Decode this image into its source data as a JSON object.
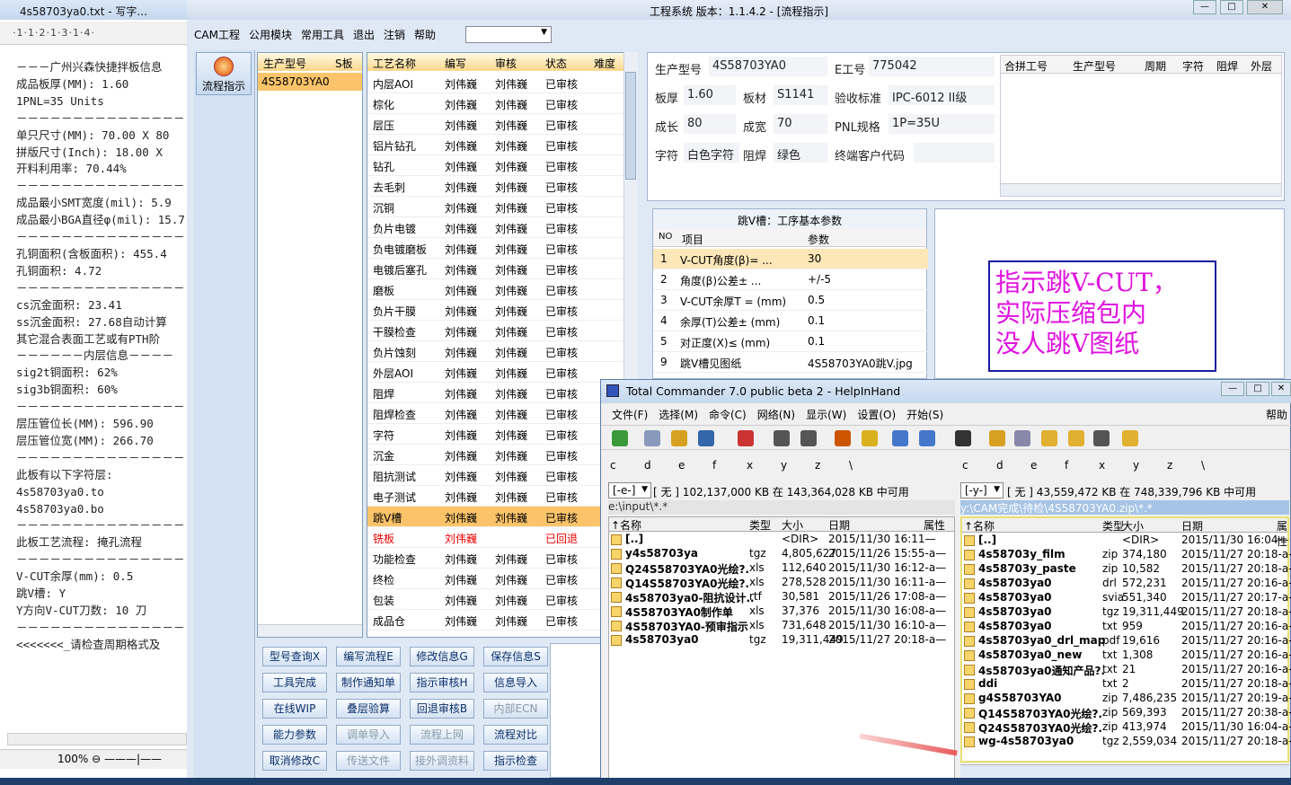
{
  "notepad": {
    "title": "4s58703ya0.txt - 写字...",
    "ruler": "·1·1·2·1·3·1·4·",
    "lines": [
      "－－－广州兴森快捷拌板信息",
      "成品板厚(MM): 1.60",
      "1PNL=35 Units",
      "－－－－－－－－－－－－－－－",
      "单只尺寸(MM): 70.00 X 80",
      "拼版尺寸(Inch): 18.00 X",
      "开料利用率: 70.44%",
      "－－－－－－－－－－－－－－－",
      "成品最小SMT宽度(mil): 5.9",
      "成品最小BGA直径φ(mil): 15.7",
      "－－－－－－－－－－－－－－－",
      "孔铜面积(含板面积): 455.4",
      "孔铜面积: 4.72",
      "－－－－－－－－－－－－－－－",
      "cs沉金面积: 23.41",
      "ss沉金面积: 27.68自动计算",
      "其它混合表面工艺或有PTH阶",
      "－－－－－－内层信息－－－－",
      "sig2t铜面积: 62%",
      "sig3b铜面积: 60%",
      "－－－－－－－－－－－－－－－",
      "层压管位长(MM): 596.90",
      "层压管位宽(MM): 266.70",
      "－－－－－－－－－－－－－－－",
      "此板有以下字符层:",
      "4s58703ya0.to",
      "4s58703ya0.bo",
      "－－－－－－－－－－－－－－－",
      "此板工艺流程: 掩孔流程",
      "－－－－－－－－－－－－－－－",
      "V-CUT余厚(mm): 0.5",
      "跳V槽: Y",
      "Y方向V-CUT刀数: 10 刀",
      "－－－－－－－－－－－－－－－",
      "<<<<<<<_请检查周期格式及"
    ],
    "zoom": "100%"
  },
  "app": {
    "title": "工程系统   版本：1.1.4.2 - [流程指示]",
    "menu": [
      "CAM工程",
      "公用模块",
      "常用工具",
      "退出",
      "注销",
      "帮助"
    ],
    "left_button": "流程指示",
    "prod_list": {
      "headers": [
        "生产型号",
        "S板"
      ],
      "rows": [
        "4S58703YA0"
      ]
    },
    "proc_list": {
      "headers": [
        "工艺名称",
        "编写",
        "审核",
        "状态",
        "难度"
      ],
      "rows": [
        [
          "内层AOI",
          "刘伟巍",
          "刘伟巍",
          "已审核"
        ],
        [
          "棕化",
          "刘伟巍",
          "刘伟巍",
          "已审核"
        ],
        [
          "层压",
          "刘伟巍",
          "刘伟巍",
          "已审核"
        ],
        [
          "铝片钻孔",
          "刘伟巍",
          "刘伟巍",
          "已审核"
        ],
        [
          "钻孔",
          "刘伟巍",
          "刘伟巍",
          "已审核"
        ],
        [
          "去毛刺",
          "刘伟巍",
          "刘伟巍",
          "已审核"
        ],
        [
          "沉铜",
          "刘伟巍",
          "刘伟巍",
          "已审核"
        ],
        [
          "负片电镀",
          "刘伟巍",
          "刘伟巍",
          "已审核"
        ],
        [
          "负电镀磨板",
          "刘伟巍",
          "刘伟巍",
          "已审核"
        ],
        [
          "电镀后塞孔",
          "刘伟巍",
          "刘伟巍",
          "已审核"
        ],
        [
          "磨板",
          "刘伟巍",
          "刘伟巍",
          "已审核"
        ],
        [
          "负片干膜",
          "刘伟巍",
          "刘伟巍",
          "已审核"
        ],
        [
          "干膜检查",
          "刘伟巍",
          "刘伟巍",
          "已审核"
        ],
        [
          "负片蚀刻",
          "刘伟巍",
          "刘伟巍",
          "已审核"
        ],
        [
          "外层AOI",
          "刘伟巍",
          "刘伟巍",
          "已审核"
        ],
        [
          "阻焊",
          "刘伟巍",
          "刘伟巍",
          "已审核"
        ],
        [
          "阻焊检查",
          "刘伟巍",
          "刘伟巍",
          "已审核"
        ],
        [
          "字符",
          "刘伟巍",
          "刘伟巍",
          "已审核"
        ],
        [
          "沉金",
          "刘伟巍",
          "刘伟巍",
          "已审核"
        ],
        [
          "阻抗测试",
          "刘伟巍",
          "刘伟巍",
          "已审核"
        ],
        [
          "电子测试",
          "刘伟巍",
          "刘伟巍",
          "已审核"
        ],
        [
          "跳V槽",
          "刘伟巍",
          "刘伟巍",
          "已审核"
        ],
        [
          "铣板",
          "刘伟巍",
          "",
          "已回退"
        ],
        [
          "功能检查",
          "刘伟巍",
          "刘伟巍",
          "已审核"
        ],
        [
          "终检",
          "刘伟巍",
          "刘伟巍",
          "已审核"
        ],
        [
          "包装",
          "刘伟巍",
          "刘伟巍",
          "已审核"
        ],
        [
          "成品仓",
          "刘伟巍",
          "刘伟巍",
          "已审核"
        ]
      ]
    },
    "buttons": [
      [
        "型号查询X",
        "编写流程E",
        "修改信息G",
        "保存信息S"
      ],
      [
        "工具完成",
        "制作通知单",
        "指示审核H",
        "信息导入"
      ],
      [
        "在线WIP",
        "叠层验算",
        "回退审核B",
        "内部ECN"
      ],
      [
        "能力参数",
        "调单导入",
        "流程上网",
        "流程对比"
      ],
      [
        "取消修改C",
        "传送文件",
        "接外调资料",
        "指示检查"
      ]
    ],
    "info": {
      "prod_label": "生产型号",
      "prod": "4S58703YA0",
      "e_label": "E工号",
      "e": "775042",
      "thick_label": "板厚",
      "thick": "1.60",
      "mat_label": "板材",
      "mat": "S1141",
      "std_label": "验收标准",
      "std": "IPC-6012 II级",
      "len_label": "成长",
      "len": "80",
      "wid_label": "成宽",
      "wid": "70",
      "pnl_label": "PNL规格",
      "pnl": "1P=35U",
      "char_label": "字符",
      "char": "白色字符",
      "mask_label": "阻焊",
      "mask": "绿色",
      "cust_label": "终端客户代码",
      "right_headers": [
        "合拼工号",
        "生产型号",
        "周期",
        "字符",
        "阻焊",
        "外层"
      ]
    },
    "param_table": {
      "title": "跳V槽：工序基本参数",
      "headers": [
        "NO",
        "项目",
        "参数"
      ],
      "rows": [
        [
          "1",
          "V-CUT角度(β)=   ...",
          "30"
        ],
        [
          "2",
          "角度(β)公差±   ...",
          "+/-5"
        ],
        [
          "3",
          "V-CUT余厚T =  (mm)",
          "0.5"
        ],
        [
          "4",
          "余厚(T)公差±  (mm)",
          "0.1"
        ],
        [
          "5",
          "对正度(X)≤ (mm)",
          "0.1"
        ],
        [
          "9",
          "跳V槽见图纸",
          "4S58703YA0跳V.jpg"
        ]
      ]
    },
    "note": [
      "指示跳V-CUT，",
      "实际压缩包内",
      "没人跳V图纸"
    ]
  },
  "tc": {
    "title": "Total Commander 7.0 public beta 2 - HelpInHand",
    "menu": [
      "文件(F)",
      "选择(M)",
      "命令(C)",
      "网络(N)",
      "显示(W)",
      "设置(O)",
      "开始(S)"
    ],
    "help": "帮助",
    "drives_left": [
      "c",
      "d",
      "e",
      "f",
      "x",
      "y",
      "z",
      "\\"
    ],
    "drives_right": [
      "c",
      "d",
      "e",
      "f",
      "x",
      "y",
      "z",
      "\\"
    ],
    "left": {
      "drive": "[-e-]",
      "info": "[ 无 ]  102,137,000 KB 在 143,364,028 KB 中可用",
      "path": "e:\\input\\*.*",
      "headers": [
        "↑名称",
        "类型",
        "大小",
        "日期",
        "属性"
      ],
      "files": [
        [
          "[..]",
          "",
          "<DIR>",
          "2015/11/30 16:11—"
        ],
        [
          "y4s58703ya",
          "tgz",
          "4,805,627",
          "2015/11/26 15:55-a—"
        ],
        [
          "Q24S58703YA0光绘?.",
          "xls",
          "112,640",
          "2015/11/30 16:12-a—"
        ],
        [
          "Q14S58703YA0光绘?.",
          "xls",
          "278,528",
          "2015/11/30 16:11-a—"
        ],
        [
          "4s58703ya0-阻抗设计..",
          "rtf",
          "30,581",
          "2015/11/26 17:08-a—"
        ],
        [
          "4S58703YA0制作单",
          "xls",
          "37,376",
          "2015/11/30 16:08-a—"
        ],
        [
          "4S58703YA0-预审指示",
          "xls",
          "731,648",
          "2015/11/30 16:10-a—"
        ],
        [
          "4s58703ya0",
          "tgz",
          "19,311,449",
          "2015/11/27 20:18-a—"
        ]
      ]
    },
    "right": {
      "drive": "[-y-]",
      "info": "[ 无 ]  43,559,472 KB 在 748,339,796 KB 中可用",
      "path": "y:\\CAM完成\\待检\\4S58703YA0.zip\\*.*",
      "headers": [
        "↑名称",
        "类型",
        "大小",
        "日期",
        "属性"
      ],
      "files": [
        [
          "[..]",
          "",
          "<DIR>",
          "2015/11/30 16:04—"
        ],
        [
          "4s58703y_film",
          "zip",
          "374,180",
          "2015/11/27 20:18-a—"
        ],
        [
          "4s58703y_paste",
          "zip",
          "10,582",
          "2015/11/27 20:18-a—"
        ],
        [
          "4s58703ya0",
          "drl",
          "572,231",
          "2015/11/27 20:16-a—"
        ],
        [
          "4s58703ya0",
          "svia",
          "551,340",
          "2015/11/27 20:17-a—"
        ],
        [
          "4s58703ya0",
          "tgz",
          "19,311,449",
          "2015/11/27 20:18-a—"
        ],
        [
          "4s58703ya0",
          "txt",
          "959",
          "2015/11/27 20:16-a—"
        ],
        [
          "4s58703ya0_drl_map",
          "pdf",
          "19,616",
          "2015/11/27 20:16-a—"
        ],
        [
          "4s58703ya0_new",
          "txt",
          "1,308",
          "2015/11/27 20:16-a—"
        ],
        [
          "4s58703ya0通知产品?.",
          "txt",
          "21",
          "2015/11/27 20:16-a—"
        ],
        [
          "ddi",
          "txt",
          "2",
          "2015/11/27 20:18-a—"
        ],
        [
          "g4S58703YA0",
          "zip",
          "7,486,235",
          "2015/11/27 20:19-a—"
        ],
        [
          "Q14S58703YA0光绘?.",
          "zip",
          "569,393",
          "2015/11/27 20:38-a—"
        ],
        [
          "Q24S58703YA0光绘?.",
          "zip",
          "413,974",
          "2015/11/30 16:04-a—"
        ],
        [
          "wg-4s58703ya0",
          "tgz",
          "2,559,034",
          "2015/11/27 20:18-a—"
        ]
      ]
    }
  }
}
